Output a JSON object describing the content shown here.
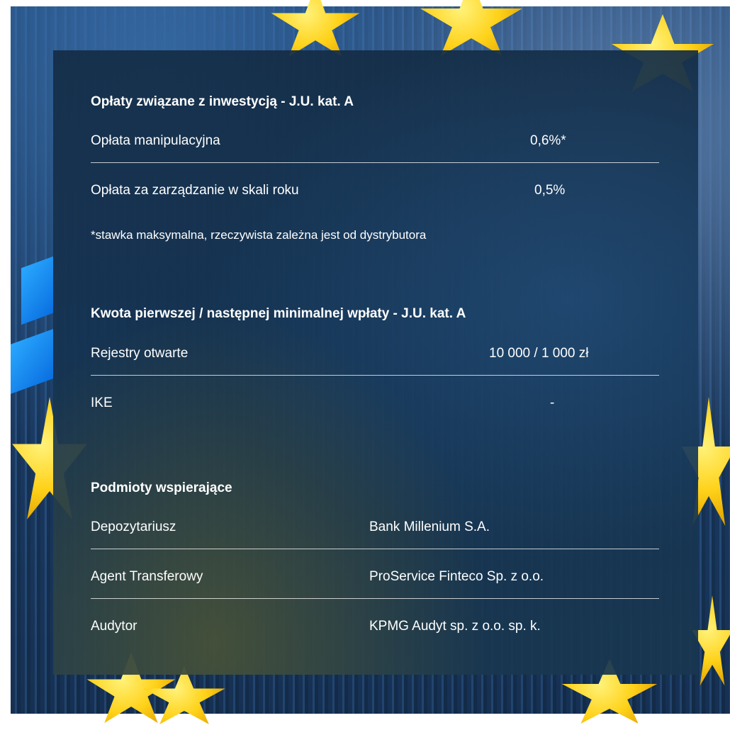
{
  "fees": {
    "title": "Opłaty związane z inwestycją - J.U. kat. A",
    "rows": [
      {
        "label": "Opłata manipulacyjna",
        "value": "0,6%*"
      },
      {
        "label": "Opłata za zarządzanie w skali roku",
        "value": "0,5%"
      }
    ],
    "note": "*stawka maksymalna, rzeczywista zależna jest od dystrybutora"
  },
  "payments": {
    "title": "Kwota pierwszej / następnej minimalnej wpłaty - J.U. kat. A",
    "rows": [
      {
        "label": "Rejestry otwarte",
        "value": "10 000 / 1 000 zł"
      },
      {
        "label": "IKE",
        "value": "-"
      }
    ]
  },
  "entities": {
    "title": "Podmioty wspierające",
    "rows": [
      {
        "label": "Depozytariusz",
        "value": "Bank Millenium S.A."
      },
      {
        "label": "Agent Transferowy",
        "value": "ProService Finteco Sp. z o.o."
      },
      {
        "label": "Audytor",
        "value": "KPMG Audyt sp. z o.o. sp. k."
      }
    ]
  }
}
